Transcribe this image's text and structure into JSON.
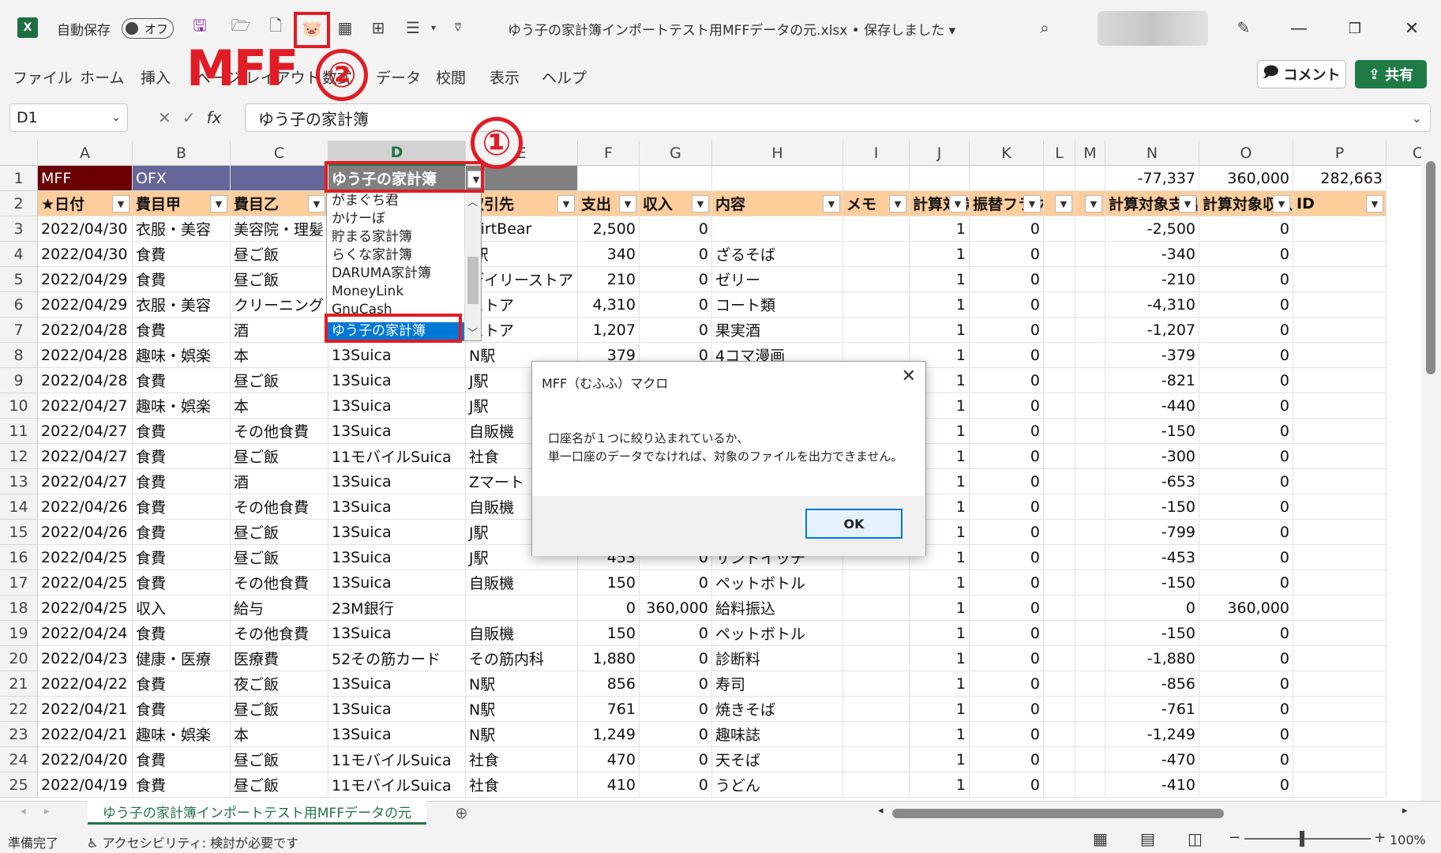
{
  "titlebar": {
    "autosave_label": "自動保存",
    "autosave_state": "オフ",
    "filename": "ゆう子の家計簿インポートテスト用MFFデータの元.xlsx • 保存しました",
    "icons": [
      "excel-logo",
      "save-icon",
      "open-folder-icon",
      "new-file-icon",
      "mff-piggybank-icon",
      "calculator-icon",
      "hierarchy-icon",
      "form-icon",
      "customize-icon",
      "search-icon",
      "pen-icon",
      "minimize-icon",
      "restore-icon",
      "close-icon"
    ]
  },
  "ribbon": {
    "tabs": [
      "ファイル",
      "ホーム",
      "挿入",
      "ページ レイアウト",
      "数式",
      "データ",
      "校閲",
      "表示",
      "ヘルプ"
    ],
    "comment_label": "コメント",
    "share_label": "共有"
  },
  "annotations": {
    "mff_label": "MFF",
    "step1": "①",
    "step2": "②"
  },
  "formula_bar": {
    "name_box": "D1",
    "fx": "fx",
    "content": "ゆう子の家計簿"
  },
  "columns": [
    "A",
    "B",
    "C",
    "D",
    "E",
    "F",
    "G",
    "H",
    "I",
    "J",
    "K",
    "L",
    "M",
    "N",
    "O",
    "P",
    "C"
  ],
  "row1": {
    "A": "MFF",
    "B": "OFX",
    "D": "ゆう子の家計簿",
    "N": "-77,337",
    "O": "360,000",
    "P": "282,663"
  },
  "headers": [
    "★日付",
    "費目甲",
    "費目乙",
    "",
    "取引先",
    "支出",
    "収入",
    "内容",
    "メモ",
    "計算対象",
    "振替フラグ",
    "",
    "",
    "計算対象支出",
    "計算対象収入",
    "ID"
  ],
  "rows": [
    [
      "2022/04/30",
      "衣服・美容",
      "美容院・理髪",
      "",
      "DirtBear",
      "2,500",
      "0",
      "",
      "",
      "1",
      "0",
      "",
      "",
      "-2,500",
      "0"
    ],
    [
      "2022/04/30",
      "食費",
      "昼ご飯",
      "",
      "J駅",
      "340",
      "0",
      "ざるそば",
      "",
      "1",
      "0",
      "",
      "",
      "-340",
      "0"
    ],
    [
      "2022/04/29",
      "食費",
      "昼ご飯",
      "",
      "デイリーストア",
      "210",
      "0",
      "ゼリー",
      "",
      "1",
      "0",
      "",
      "",
      "-210",
      "0"
    ],
    [
      "2022/04/29",
      "衣服・美容",
      "クリーニング",
      "",
      "ストア",
      "4,310",
      "0",
      "コート類",
      "",
      "1",
      "0",
      "",
      "",
      "-4,310",
      "0"
    ],
    [
      "2022/04/28",
      "食費",
      "酒",
      "",
      "ストア",
      "1,207",
      "0",
      "果実酒",
      "",
      "1",
      "0",
      "",
      "",
      "-1,207",
      "0"
    ],
    [
      "2022/04/28",
      "趣味・娯楽",
      "本",
      "13Suica",
      "N駅",
      "379",
      "0",
      "4コマ漫画",
      "",
      "1",
      "0",
      "",
      "",
      "-379",
      "0"
    ],
    [
      "2022/04/28",
      "食費",
      "昼ご飯",
      "13Suica",
      "J駅",
      "",
      "",
      "",
      "",
      "1",
      "0",
      "",
      "",
      "-821",
      "0"
    ],
    [
      "2022/04/27",
      "趣味・娯楽",
      "本",
      "13Suica",
      "J駅",
      "",
      "",
      "",
      "",
      "1",
      "0",
      "",
      "",
      "-440",
      "0"
    ],
    [
      "2022/04/27",
      "食費",
      "その他食費",
      "13Suica",
      "自販機",
      "",
      "",
      "",
      "",
      "1",
      "0",
      "",
      "",
      "-150",
      "0"
    ],
    [
      "2022/04/27",
      "食費",
      "昼ご飯",
      "11モバイルSuica",
      "社食",
      "",
      "",
      "",
      "",
      "1",
      "0",
      "",
      "",
      "-300",
      "0"
    ],
    [
      "2022/04/27",
      "食費",
      "酒",
      "13Suica",
      "Zマート",
      "",
      "",
      "",
      "",
      "1",
      "0",
      "",
      "",
      "-653",
      "0"
    ],
    [
      "2022/04/26",
      "食費",
      "その他食費",
      "13Suica",
      "自販機",
      "",
      "",
      "",
      "",
      "1",
      "0",
      "",
      "",
      "-150",
      "0"
    ],
    [
      "2022/04/26",
      "食費",
      "昼ご飯",
      "13Suica",
      "J駅",
      "",
      "",
      "",
      "",
      "1",
      "0",
      "",
      "",
      "-799",
      "0"
    ],
    [
      "2022/04/25",
      "食費",
      "昼ご飯",
      "13Suica",
      "J駅",
      "453",
      "0",
      "サンドイッチ",
      "",
      "1",
      "0",
      "",
      "",
      "-453",
      "0"
    ],
    [
      "2022/04/25",
      "食費",
      "その他食費",
      "13Suica",
      "自販機",
      "150",
      "0",
      "ペットボトル",
      "",
      "1",
      "0",
      "",
      "",
      "-150",
      "0"
    ],
    [
      "2022/04/25",
      "収入",
      "給与",
      "23M銀行",
      "",
      "0",
      "360,000",
      "給料振込",
      "",
      "1",
      "0",
      "",
      "",
      "0",
      "360,000"
    ],
    [
      "2022/04/24",
      "食費",
      "その他食費",
      "13Suica",
      "自販機",
      "150",
      "0",
      "ペットボトル",
      "",
      "1",
      "0",
      "",
      "",
      "-150",
      "0"
    ],
    [
      "2022/04/23",
      "健康・医療",
      "医療費",
      "52その筋カード",
      "その筋内科",
      "1,880",
      "0",
      "診断料",
      "",
      "1",
      "0",
      "",
      "",
      "-1,880",
      "0"
    ],
    [
      "2022/04/22",
      "食費",
      "夜ご飯",
      "13Suica",
      "N駅",
      "856",
      "0",
      "寿司",
      "",
      "1",
      "0",
      "",
      "",
      "-856",
      "0"
    ],
    [
      "2022/04/21",
      "食費",
      "昼ご飯",
      "13Suica",
      "N駅",
      "761",
      "0",
      "焼きそば",
      "",
      "1",
      "0",
      "",
      "",
      "-761",
      "0"
    ],
    [
      "2022/04/21",
      "趣味・娯楽",
      "本",
      "13Suica",
      "N駅",
      "1,249",
      "0",
      "趣味誌",
      "",
      "1",
      "0",
      "",
      "",
      "-1,249",
      "0"
    ],
    [
      "2022/04/20",
      "食費",
      "昼ご飯",
      "11モバイルSuica",
      "社食",
      "470",
      "0",
      "天そば",
      "",
      "1",
      "0",
      "",
      "",
      "-470",
      "0"
    ],
    [
      "2022/04/19",
      "食費",
      "昼ご飯",
      "11モバイルSuica",
      "社食",
      "410",
      "0",
      "うどん",
      "",
      "1",
      "0",
      "",
      "",
      "-410",
      "0"
    ]
  ],
  "dropdown": {
    "options": [
      "がまぐち君",
      "かけーぼ",
      "貯まる家計簿",
      "らくな家計簿",
      "DARUMA家計簿",
      "MoneyLink",
      "GnuCash",
      "ゆう子の家計簿"
    ],
    "selected": "ゆう子の家計簿"
  },
  "dialog": {
    "title": "MFF（むふふ）マクロ",
    "line1": "口座名が１つに絞り込まれているか、",
    "line2": "単一口座のデータでなければ、対象のファイルを出力できません。",
    "ok_label": "OK"
  },
  "sheet_tab": "ゆう子の家計簿インポートテスト用MFFデータの元",
  "status": {
    "ready": "準備完了",
    "accessibility": "アクセシビリティ: 検討が必要です",
    "zoom": "100%"
  },
  "colors": {
    "accent": "#217346",
    "header_fill": "#fdcd9c",
    "mff_fill": "#6b0000",
    "ofx_fill": "#666699",
    "alert_red": "#e01c24"
  }
}
